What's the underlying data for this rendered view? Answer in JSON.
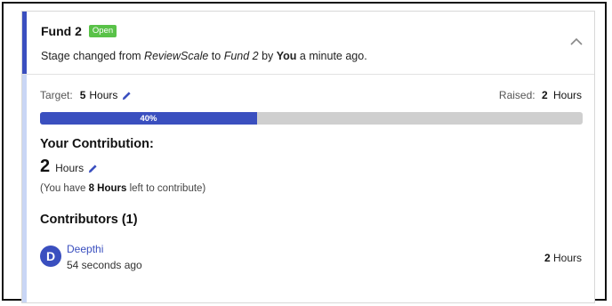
{
  "fund": {
    "title": "Fund 2",
    "status_badge": "Open",
    "stage_prefix": "Stage changed from ",
    "stage_from": "ReviewScale",
    "stage_to_word": " to ",
    "stage_to": "Fund 2",
    "stage_by_word": " by ",
    "stage_by": "You",
    "stage_time": " a minute ago."
  },
  "target": {
    "label": "Target:",
    "value": "5",
    "unit": "Hours"
  },
  "raised": {
    "label": "Raised:",
    "value": "2",
    "unit": "Hours"
  },
  "progress": {
    "percent": 40,
    "label": "40%"
  },
  "your_contribution": {
    "heading": "Your Contribution:",
    "value": "2",
    "unit": "Hours",
    "note_prefix": "(You have ",
    "note_value": "8 Hours",
    "note_suffix": " left to contribute)"
  },
  "contributors": {
    "heading": "Contributors (1)",
    "items": [
      {
        "initial": "D",
        "name": "Deepthi",
        "time": "54 seconds ago",
        "hours_value": "2",
        "hours_unit": "Hours"
      }
    ]
  },
  "colors": {
    "accent": "#3a4fbf",
    "badge": "#59c248",
    "track": "#cfcfcf",
    "stripe_light": "#c9d6f5"
  },
  "icons": {
    "collapse": "chevron-up-icon",
    "edit": "pencil-icon"
  }
}
